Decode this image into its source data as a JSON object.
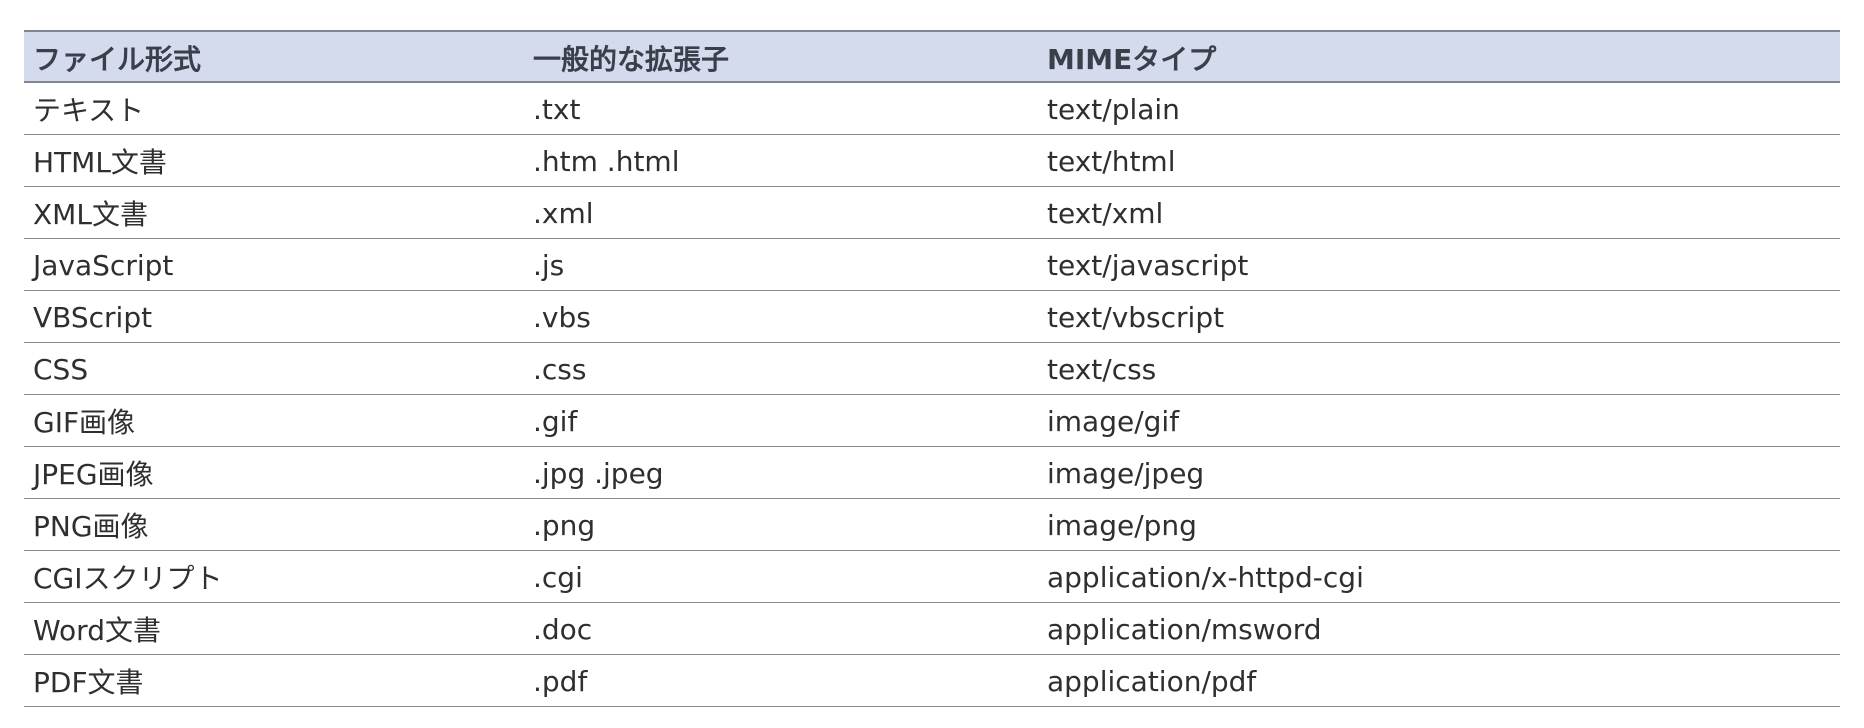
{
  "table": {
    "headers": [
      "ファイル形式",
      "一般的な拡張子",
      "MIMEタイプ"
    ],
    "rows": [
      [
        "テキスト",
        ".txt",
        "text/plain"
      ],
      [
        "HTML文書",
        ".htm .html",
        "text/html"
      ],
      [
        "XML文書",
        ".xml",
        "text/xml"
      ],
      [
        "JavaScript",
        ".js",
        "text/javascript"
      ],
      [
        "VBScript",
        ".vbs",
        "text/vbscript"
      ],
      [
        "CSS",
        ".css",
        "text/css"
      ],
      [
        "GIF画像",
        ".gif",
        "image/gif"
      ],
      [
        "JPEG画像",
        ".jpg .jpeg",
        "image/jpeg"
      ],
      [
        "PNG画像",
        ".png",
        "image/png"
      ],
      [
        "CGIスクリプト",
        ".cgi",
        "application/x-httpd-cgi"
      ],
      [
        "Word文書",
        ".doc",
        "application/msword"
      ],
      [
        "PDF文書",
        ".pdf",
        "application/pdf"
      ]
    ]
  },
  "colors": {
    "header_background": "#d4dbed",
    "rule": "#8a8a8a",
    "text": "#2f2f2f"
  }
}
